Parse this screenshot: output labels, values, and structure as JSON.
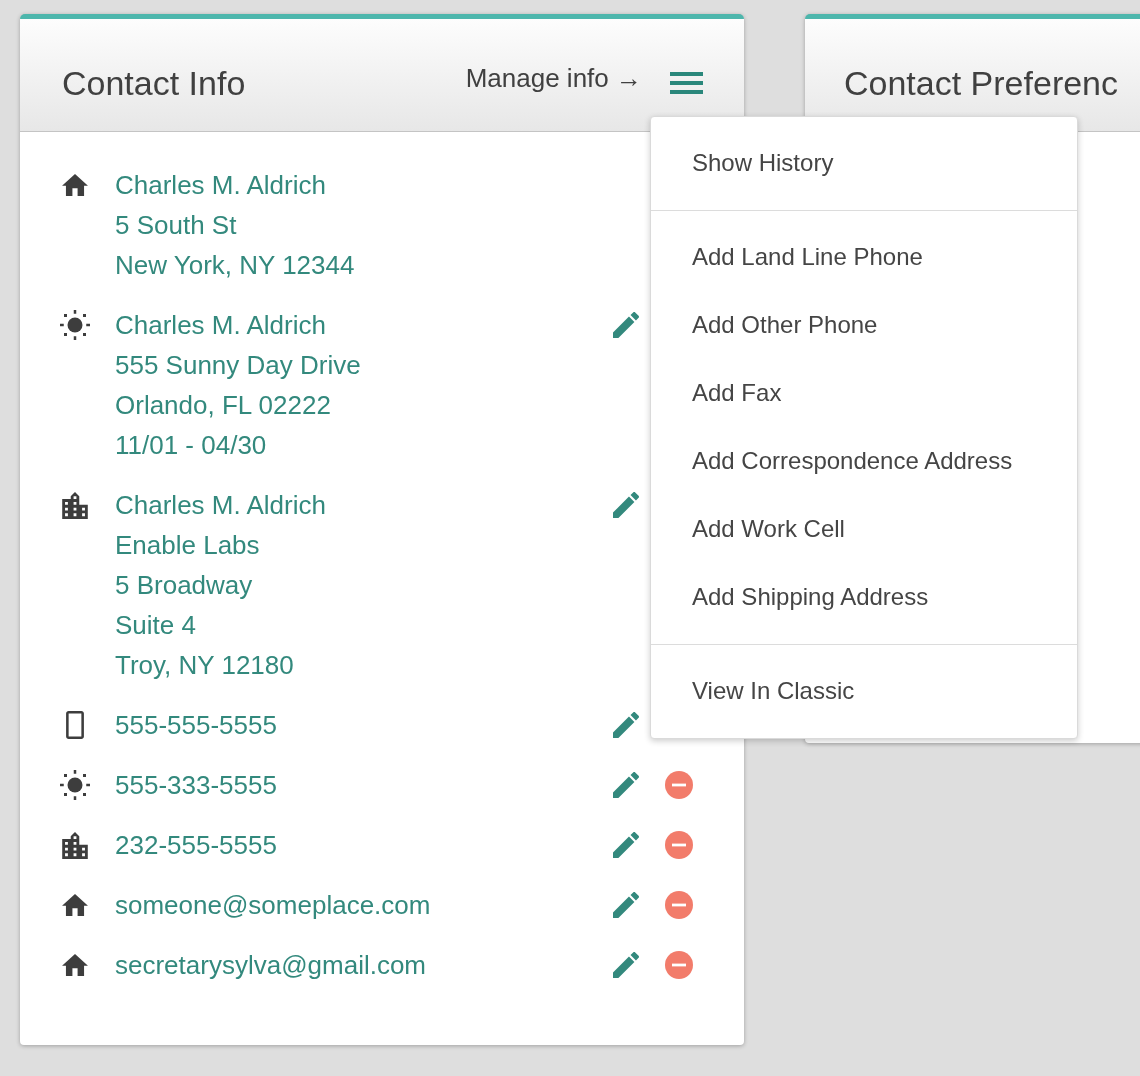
{
  "contact_card": {
    "title": "Contact Info",
    "manage_link": "Manage info →",
    "entries": [
      {
        "kind": "home",
        "lines": [
          "Charles M. Aldrich",
          "5 South St",
          "New York, NY 12344"
        ],
        "editable": false
      },
      {
        "kind": "sun",
        "lines": [
          "Charles M. Aldrich",
          "555 Sunny Day Drive",
          "Orlando, FL 02222",
          "11/01 - 04/30"
        ],
        "editable": true
      },
      {
        "kind": "building",
        "lines": [
          "Charles M. Aldrich",
          "Enable Labs",
          "5 Broadway",
          "Suite 4",
          "Troy, NY 12180"
        ],
        "editable": true
      },
      {
        "kind": "smartphone",
        "lines": [
          "555-555-5555"
        ],
        "editable": true
      },
      {
        "kind": "sun",
        "lines": [
          "555-333-5555"
        ],
        "editable": true,
        "removable": true
      },
      {
        "kind": "building",
        "lines": [
          "232-555-5555"
        ],
        "editable": true,
        "removable": true
      },
      {
        "kind": "home",
        "lines": [
          "someone@someplace.com"
        ],
        "editable": true,
        "removable": true
      },
      {
        "kind": "home",
        "lines": [
          "secretarysylva@gmail.com"
        ],
        "editable": true,
        "removable": true
      }
    ]
  },
  "menu": {
    "open": true,
    "sections": [
      {
        "items": [
          "Show History"
        ]
      },
      {
        "items": [
          "Add Land Line Phone",
          "Add Other Phone",
          "Add Fax",
          "Add Correspondence Address",
          "Add Work Cell",
          "Add Shipping Address"
        ]
      },
      {
        "items": [
          "View In Classic"
        ]
      }
    ]
  },
  "preferences_card": {
    "title": "Contact Preferenc"
  }
}
